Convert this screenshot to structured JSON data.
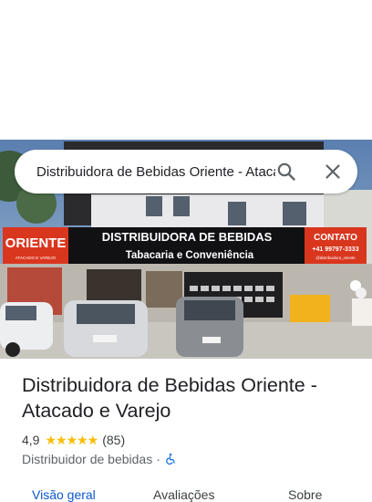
{
  "search": {
    "query": "Distribuidora de Bebidas Oriente - Atacado e Varejo"
  },
  "storefront": {
    "sign_main": "DISTRIBUIDORA DE BEBIDAS",
    "sign_sub": "Tabacaria e Conveniência",
    "brand_logo": "ORIENTE",
    "brand_tagline": "ATACADO E VAREJO",
    "contact_title": "CONTATO",
    "contact_phone": "+41 99797-3333",
    "contact_handle": "@distribuidora_oriente"
  },
  "place": {
    "name": "Distribuidora de Bebidas Oriente - Atacado e Varejo",
    "rating": "4,9",
    "stars": "★★★★★",
    "reviews": "(85)",
    "category": "Distribuidor de bebidas",
    "separator": "·",
    "accessibility_icon": "wheelchair-icon"
  },
  "tabs": [
    {
      "label": "Visão geral",
      "active": true
    },
    {
      "label": "Avaliações",
      "active": false
    },
    {
      "label": "Sobre",
      "active": false
    }
  ],
  "colors": {
    "accent": "#0b57d0",
    "star": "#fbbc04",
    "sign_red": "#d9361e"
  }
}
